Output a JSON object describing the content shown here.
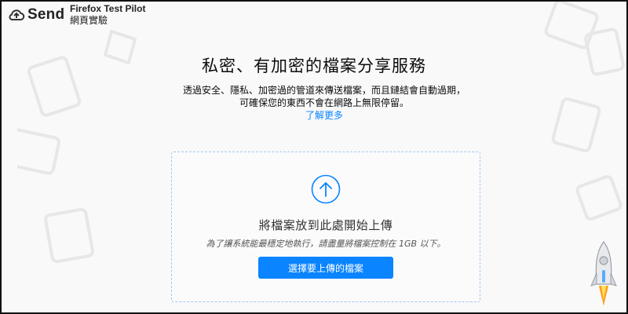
{
  "header": {
    "app_name": "Send",
    "test_pilot_label": "Firefox Test Pilot",
    "experiment_label": "網頁實驗"
  },
  "intro": {
    "title": "私密、有加密的檔案分享服務",
    "description_line1": "透過安全、隱私、加密過的管道來傳送檔案，而且鏈結會自動過期，",
    "description_line2": "可確保您的東西不會在網路上無限停留。",
    "learn_more": "了解更多"
  },
  "upload": {
    "title": "將檔案放到此處開始上傳",
    "note": "為了讓系統能最穩定地執行，請盡量將檔案控制在 1GB 以下。",
    "button_label": "選擇要上傳的檔案"
  },
  "icons": {
    "brand": "cloud-send-icon",
    "upload": "arrow-up-circle-icon",
    "mascot": "rocket-icon"
  },
  "colors": {
    "accent": "#0a84ff",
    "background": "#f9f9fa",
    "dashed_border": "#9fc7ee"
  }
}
